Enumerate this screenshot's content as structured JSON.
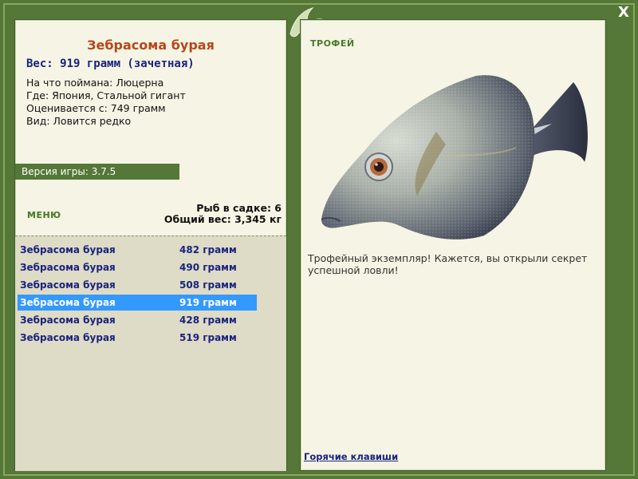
{
  "window": {
    "close_label": "X"
  },
  "fish": {
    "title": "Зебрасома бурая",
    "weight_line": "Вес: 919 грамм (зачетная)",
    "caught_on": "На что поймана: Люцерна",
    "where": "Где: Япония, Стальной гигант",
    "valued_from": "Оценивается с: 749 грамм",
    "kind": "Вид: Ловится редко"
  },
  "version": "Версия игры: 3.7.5",
  "menu_label": "МЕНЮ",
  "keepnet": {
    "count": "Рыб в садке: 6",
    "total_weight": "Общий вес: 3,345 кг",
    "items": [
      {
        "name": "Зебрасома бурая",
        "weight": "482 грамм"
      },
      {
        "name": "Зебрасома бурая",
        "weight": "490 грамм"
      },
      {
        "name": "Зебрасома бурая",
        "weight": "508 грамм"
      },
      {
        "name": "Зебрасома бурая",
        "weight": "919 грамм"
      },
      {
        "name": "Зебрасома бурая",
        "weight": "428 грамм"
      },
      {
        "name": "Зебрасома бурая",
        "weight": "519 грамм"
      }
    ],
    "selected_index": 3
  },
  "trophy": {
    "label": "ТРОФЕЙ",
    "text": "Трофейный экземпляр! Кажется, вы открыли секрет успешной ловли!",
    "hotkeys_link": "Горячие клавиши"
  },
  "colors": {
    "frame_green": "#557838",
    "panel_bg": "#f6f4e4",
    "list_bg": "#dedbc6",
    "selection": "#3399ff",
    "title_orange": "#b5471a",
    "text_navy": "#1a237e"
  }
}
